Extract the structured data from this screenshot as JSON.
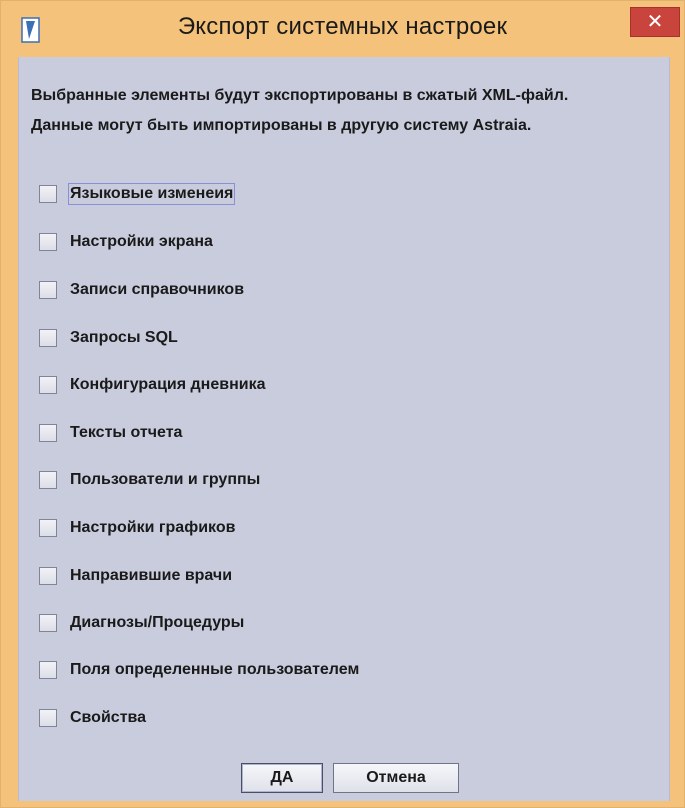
{
  "window": {
    "title": "Экспорт системных настроек",
    "close_glyph": "✕",
    "app_icon": "document-icon"
  },
  "description": {
    "line1": "Выбранные элементы будут экспортированы в сжатый XML-файл.",
    "line2": "Данные могут быть импортированы в другую систему Astraia."
  },
  "options": [
    {
      "label": "Языковые изменеия",
      "checked": false,
      "focused": true
    },
    {
      "label": "Настройки экрана",
      "checked": false
    },
    {
      "label": "Записи справочников",
      "checked": false
    },
    {
      "label": "Запросы SQL",
      "checked": false
    },
    {
      "label": "Конфигурация дневника",
      "checked": false
    },
    {
      "label": "Тексты отчета",
      "checked": false
    },
    {
      "label": "Пользователи и группы",
      "checked": false
    },
    {
      "label": "Настройки графиков",
      "checked": false
    },
    {
      "label": "Направившие врачи",
      "checked": false
    },
    {
      "label": "Диагнозы/Процедуры",
      "checked": false
    },
    {
      "label": "Поля определенные пользователем",
      "checked": false
    },
    {
      "label": "Свойства",
      "checked": false
    }
  ],
  "buttons": {
    "ok": "ДА",
    "cancel": "Отмена"
  },
  "colors": {
    "title_bar": "#f4c27a",
    "client_bg": "#c9ccdd",
    "close_button": "#c8443d"
  }
}
